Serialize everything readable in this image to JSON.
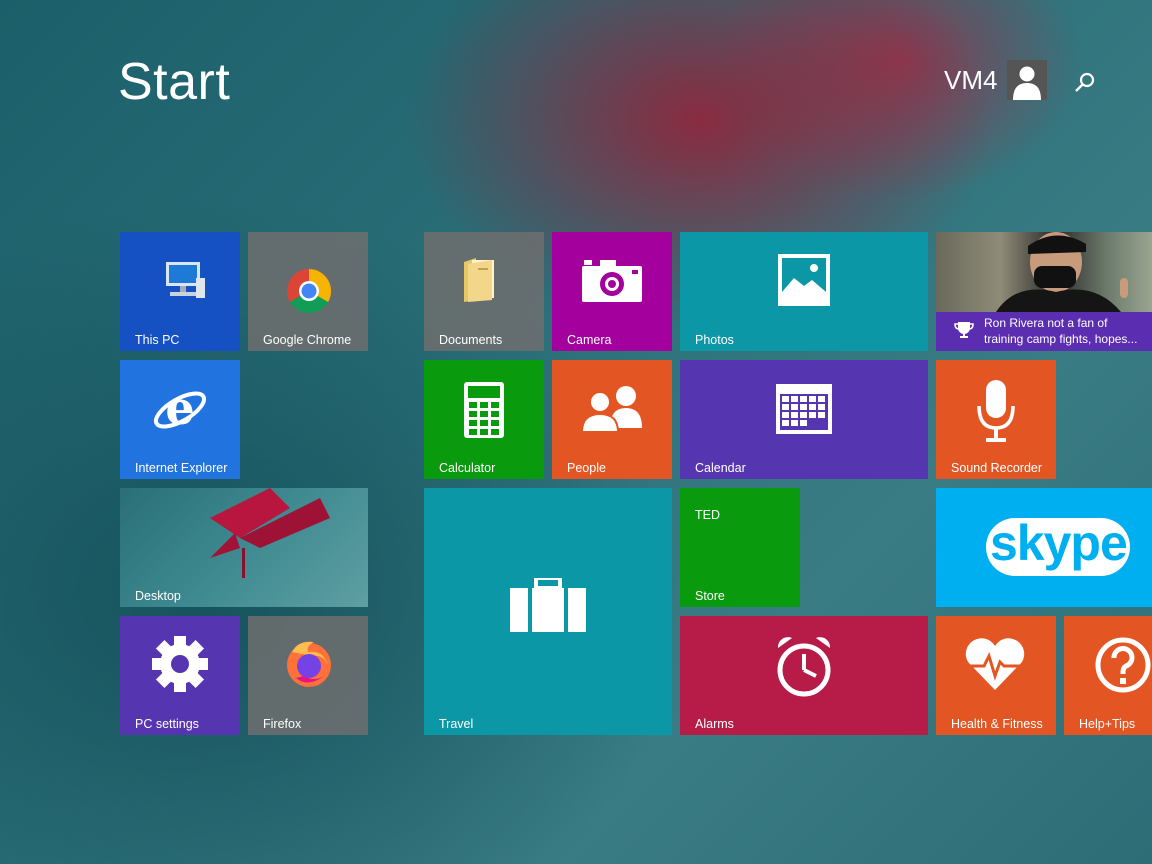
{
  "header": {
    "title": "Start",
    "user_name": "VM4"
  },
  "tiles": {
    "this_pc": "This PC",
    "chrome": "Google Chrome",
    "documents": "Documents",
    "camera": "Camera",
    "photos": "Photos",
    "news_headline": "Ron Rivera not a fan of training camp fights, hopes...",
    "ie": "Internet Explorer",
    "calculator": "Calculator",
    "people": "People",
    "calendar": "Calendar",
    "sound_recorder": "Sound Recorder",
    "desktop": "Desktop",
    "travel": "Travel",
    "store_badge": "TED",
    "store": "Store",
    "skype": "skype",
    "pc_settings": "PC settings",
    "firefox": "Firefox",
    "alarms": "Alarms",
    "health": "Health & Fitness",
    "help": "Help+Tips"
  },
  "colors": {
    "blue": "#1651c4",
    "chrome_grey": "#6e6e6e",
    "magenta": "#a3009e",
    "teal": "#0b97a6",
    "green": "#0a9a0e",
    "orange": "#e35624",
    "purple": "#5536b0",
    "crimson": "#b61c47",
    "skype": "#00aff0"
  }
}
